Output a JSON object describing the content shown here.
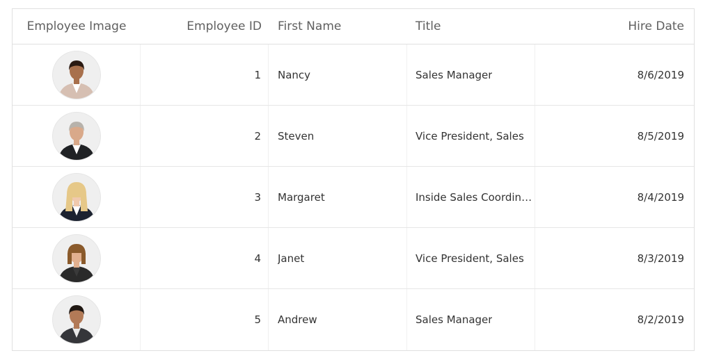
{
  "header": {
    "employee_image": "Employee Image",
    "employee_id": "Employee ID",
    "first_name": "First Name",
    "title": "Title",
    "hire_date": "Hire Date"
  },
  "rows": [
    {
      "id": "1",
      "first_name": "Nancy",
      "title": "Sales Manager",
      "hire_date": "8/6/2019",
      "avatar": {
        "hair": "#2a1a12",
        "skin": "#a8704c",
        "outfit": "#d6bfb2",
        "shirt": "#ffffff",
        "hair_style": "short"
      }
    },
    {
      "id": "2",
      "first_name": "Steven",
      "title": "Vice President, Sales",
      "hire_date": "8/5/2019",
      "avatar": {
        "hair": "#b7b2ab",
        "skin": "#d9a98a",
        "outfit": "#202225",
        "shirt": "#ffffff",
        "hair_style": "short"
      }
    },
    {
      "id": "3",
      "first_name": "Margaret",
      "title": "Inside Sales Coordinator",
      "hire_date": "8/4/2019",
      "avatar": {
        "hair": "#e6c888",
        "skin": "#f0c9ad",
        "outfit": "#1c2230",
        "shirt": "#ffffff",
        "hair_style": "long"
      }
    },
    {
      "id": "4",
      "first_name": "Janet",
      "title": "Vice President, Sales",
      "hire_date": "8/3/2019",
      "avatar": {
        "hair": "#8a5a2b",
        "skin": "#e2b08f",
        "outfit": "#2a2a2a",
        "shirt": "#3a3a3a",
        "hair_style": "bob"
      }
    },
    {
      "id": "5",
      "first_name": "Andrew",
      "title": "Sales Manager",
      "hire_date": "8/2/2019",
      "avatar": {
        "hair": "#1f1712",
        "skin": "#b27a57",
        "outfit": "#35363a",
        "shirt": "#e9e9e9",
        "hair_style": "short"
      }
    }
  ]
}
